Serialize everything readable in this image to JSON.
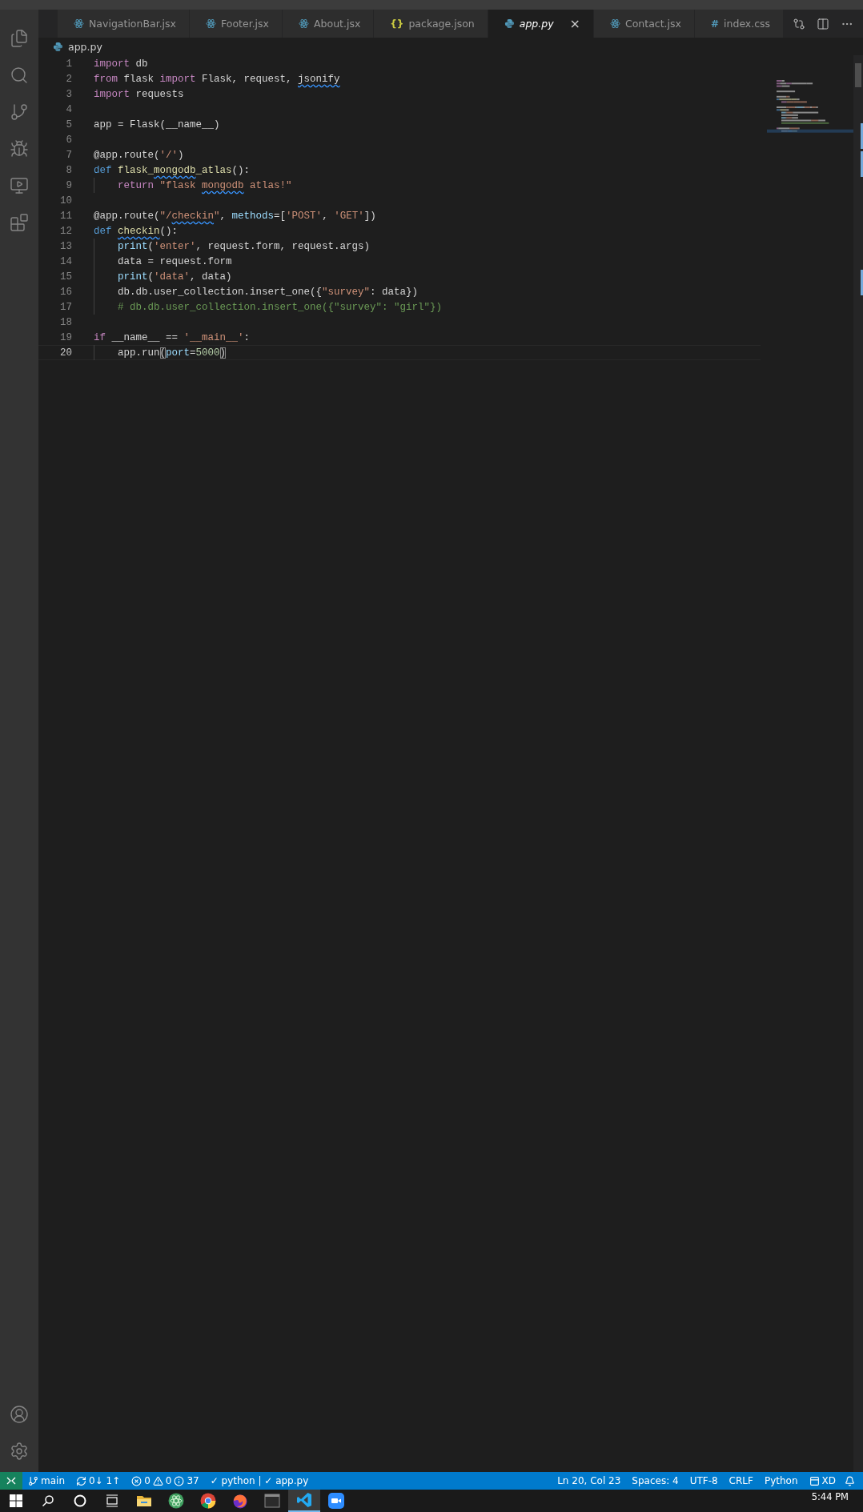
{
  "tabs": [
    {
      "label": "NavigationBar.jsx",
      "kind": "react",
      "selected": false
    },
    {
      "label": "Footer.jsx",
      "kind": "react",
      "selected": false
    },
    {
      "label": "About.jsx",
      "kind": "react",
      "selected": false
    },
    {
      "label": "package.json",
      "kind": "json",
      "icon_text": "{}",
      "selected": false
    },
    {
      "label": "app.py",
      "kind": "python",
      "selected": true,
      "close": "×"
    },
    {
      "label": "Contact.jsx",
      "kind": "react",
      "selected": false
    },
    {
      "label": "index.css",
      "kind": "css",
      "icon_text": "#",
      "selected": false
    }
  ],
  "breadcrumb": "app.py",
  "lines": [
    {
      "number": "1",
      "indent": false,
      "current": false,
      "tokens": [
        {
          "kind": "keyword",
          "text": "import"
        },
        {
          "kind": "plain",
          "text": " db"
        }
      ]
    },
    {
      "number": "2",
      "indent": false,
      "current": false,
      "tokens": [
        {
          "kind": "keyword",
          "text": "from"
        },
        {
          "kind": "plain",
          "text": " flask "
        },
        {
          "kind": "keyword",
          "text": "import"
        },
        {
          "kind": "plain",
          "text": " Flask, request, "
        },
        {
          "kind": "plain",
          "text": "jsonify",
          "squiggle": true
        }
      ]
    },
    {
      "number": "3",
      "indent": false,
      "current": false,
      "tokens": [
        {
          "kind": "keyword",
          "text": "import"
        },
        {
          "kind": "plain",
          "text": " requests"
        }
      ]
    },
    {
      "number": "4",
      "indent": false,
      "current": false
    },
    {
      "number": "5",
      "indent": false,
      "current": false,
      "tokens": [
        {
          "kind": "plain",
          "text": "app = Flask(__name__)"
        }
      ]
    },
    {
      "number": "6",
      "indent": false,
      "current": false
    },
    {
      "number": "7",
      "indent": false,
      "current": false,
      "tokens": [
        {
          "kind": "plain",
          "text": "@app.route("
        },
        {
          "kind": "string",
          "text": "'/'"
        },
        {
          "kind": "plain",
          "text": ")"
        }
      ]
    },
    {
      "number": "8",
      "indent": false,
      "current": false,
      "tokens": [
        {
          "kind": "storage",
          "text": "def"
        },
        {
          "kind": "function",
          "text": " flask_"
        },
        {
          "kind": "function",
          "text": "mongodb",
          "squiggle": true
        },
        {
          "kind": "function",
          "text": "_atlas"
        },
        {
          "kind": "plain",
          "text": "():"
        }
      ]
    },
    {
      "number": "9",
      "indent": true,
      "current": false,
      "tokens": [
        {
          "kind": "keyword",
          "text": "return"
        },
        {
          "kind": "string",
          "text": " \"flask "
        },
        {
          "kind": "string",
          "text": "mongodb",
          "squiggle": true
        },
        {
          "kind": "string",
          "text": " atlas!\""
        }
      ]
    },
    {
      "number": "10",
      "indent": false,
      "current": false
    },
    {
      "number": "11",
      "indent": false,
      "current": false,
      "tokens": [
        {
          "kind": "plain",
          "text": "@app.route("
        },
        {
          "kind": "string",
          "text": "\"/"
        },
        {
          "kind": "string",
          "text": "checkin",
          "squiggle": true
        },
        {
          "kind": "string",
          "text": "\""
        },
        {
          "kind": "plain",
          "text": ", "
        },
        {
          "kind": "variable",
          "text": "methods"
        },
        {
          "kind": "plain",
          "text": "=["
        },
        {
          "kind": "string",
          "text": "'POST'"
        },
        {
          "kind": "plain",
          "text": ", "
        },
        {
          "kind": "string",
          "text": "'GET'"
        },
        {
          "kind": "plain",
          "text": "])"
        }
      ]
    },
    {
      "number": "12",
      "indent": false,
      "current": false,
      "tokens": [
        {
          "kind": "storage",
          "text": "def "
        },
        {
          "kind": "function",
          "text": "checkin",
          "squiggle": true
        },
        {
          "kind": "plain",
          "text": "():"
        }
      ]
    },
    {
      "number": "13",
      "indent": true,
      "current": false,
      "tokens": [
        {
          "kind": "builtin",
          "text": "print"
        },
        {
          "kind": "plain",
          "text": "("
        },
        {
          "kind": "string",
          "text": "'enter'"
        },
        {
          "kind": "plain",
          "text": ", request.form, request.args)"
        }
      ]
    },
    {
      "number": "14",
      "indent": true,
      "current": false,
      "tokens": [
        {
          "kind": "plain",
          "text": "data = request.form"
        }
      ]
    },
    {
      "number": "15",
      "indent": true,
      "current": false,
      "tokens": [
        {
          "kind": "builtin",
          "text": "print"
        },
        {
          "kind": "plain",
          "text": "("
        },
        {
          "kind": "string",
          "text": "'data'"
        },
        {
          "kind": "plain",
          "text": ", data)"
        }
      ]
    },
    {
      "number": "16",
      "indent": true,
      "current": false,
      "tokens": [
        {
          "kind": "plain",
          "text": "db.db.user_collection.insert_one({"
        },
        {
          "kind": "string",
          "text": "\"survey\""
        },
        {
          "kind": "plain",
          "text": ": data})"
        }
      ]
    },
    {
      "number": "17",
      "indent": true,
      "current": false,
      "tokens": [
        {
          "kind": "comment",
          "text": "# db.db.user_collection.insert_one({\"survey\": \"girl\"})"
        }
      ]
    },
    {
      "number": "18",
      "indent": false,
      "current": false
    },
    {
      "number": "19",
      "indent": false,
      "current": false,
      "tokens": [
        {
          "kind": "keyword",
          "text": "if"
        },
        {
          "kind": "plain",
          "text": " __name__ == "
        },
        {
          "kind": "string",
          "text": "'__main__'"
        },
        {
          "kind": "plain",
          "text": ":"
        }
      ]
    },
    {
      "number": "20",
      "indent": true,
      "current": true,
      "tokens": [
        {
          "kind": "plain",
          "text": "app.run"
        },
        {
          "kind": "bracket",
          "text": "("
        },
        {
          "kind": "variable",
          "text": "port"
        },
        {
          "kind": "plain",
          "text": "="
        },
        {
          "kind": "number",
          "text": "5000"
        },
        {
          "kind": "bracket",
          "text": ")"
        }
      ]
    }
  ],
  "status_bar": {
    "branch": "main",
    "sync": "0↓ 1↑",
    "errors": "0",
    "warnings": "0",
    "infos": "37",
    "checks": "✓ python | ✓ app.py",
    "right": [
      "Ln 20, Col 23",
      "Spaces: 4",
      "UTF-8",
      "CRLF",
      "Python"
    ],
    "layout": "XD"
  },
  "taskbar": {
    "apps": [
      {
        "selected": false
      },
      {
        "selected": false
      },
      {
        "selected": false
      },
      {
        "selected": false
      },
      {
        "selected": false
      },
      {
        "selected": false
      },
      {
        "selected": false
      },
      {
        "selected": false
      },
      {
        "selected": true
      },
      {
        "selected": false
      }
    ],
    "clock": "5:44 PM"
  }
}
